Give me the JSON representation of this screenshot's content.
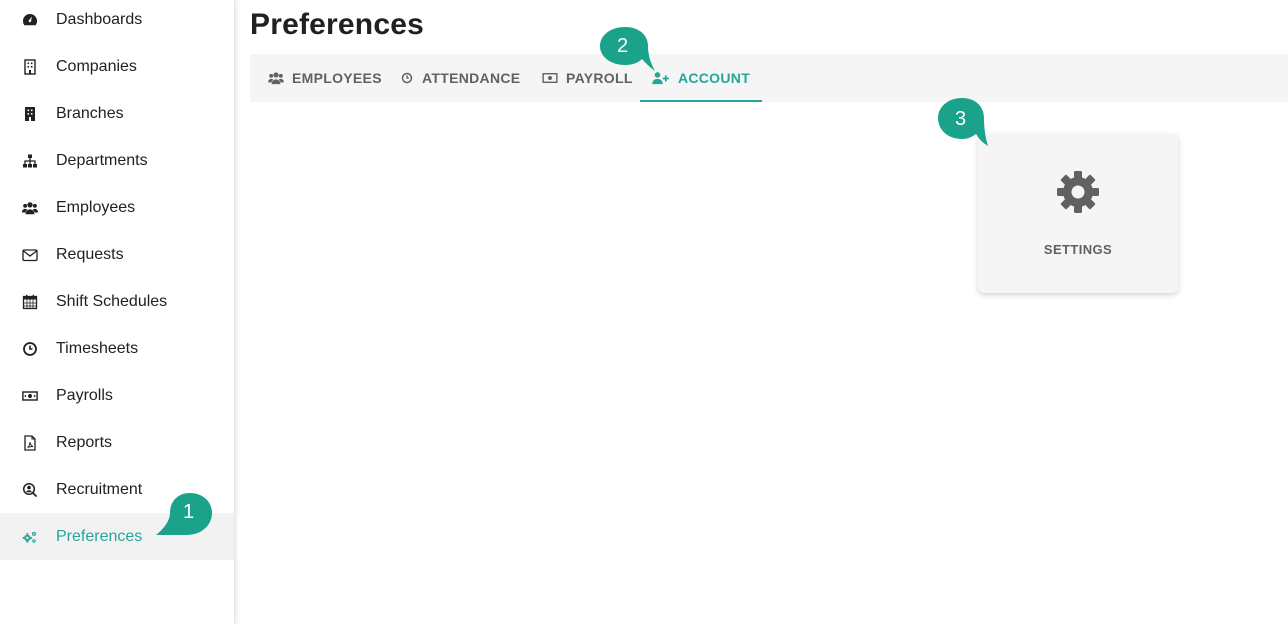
{
  "sidebar": {
    "items": [
      {
        "label": "Dashboards",
        "icon": "dashboard-icon"
      },
      {
        "label": "Companies",
        "icon": "building-outline-icon"
      },
      {
        "label": "Branches",
        "icon": "building-icon"
      },
      {
        "label": "Departments",
        "icon": "sitemap-icon"
      },
      {
        "label": "Employees",
        "icon": "users-icon"
      },
      {
        "label": "Requests",
        "icon": "envelope-icon"
      },
      {
        "label": "Shift Schedules",
        "icon": "calendar-icon"
      },
      {
        "label": "Timesheets",
        "icon": "clock-icon"
      },
      {
        "label": "Payrolls",
        "icon": "money-bill-icon"
      },
      {
        "label": "Reports",
        "icon": "pdf-file-icon"
      },
      {
        "label": "Recruitment",
        "icon": "user-search-icon"
      },
      {
        "label": "Preferences",
        "icon": "cogs-icon",
        "active": true
      }
    ]
  },
  "page": {
    "title": "Preferences"
  },
  "tabs": [
    {
      "label": "EMPLOYEES",
      "icon": "users-icon"
    },
    {
      "label": "ATTENDANCE",
      "icon": "clock-icon"
    },
    {
      "label": "PAYROLL",
      "icon": "money-bill-icon"
    },
    {
      "label": "ACCOUNT",
      "icon": "user-plus-icon",
      "active": true
    }
  ],
  "card": {
    "label": "SETTINGS",
    "icon": "gear-icon"
  },
  "markers": [
    "1",
    "2",
    "3"
  ],
  "colors": {
    "accent": "#26a69a",
    "marker": "#1aa38a",
    "text": "#212121",
    "muted": "#616161",
    "active_bg": "#f2f2f2"
  }
}
